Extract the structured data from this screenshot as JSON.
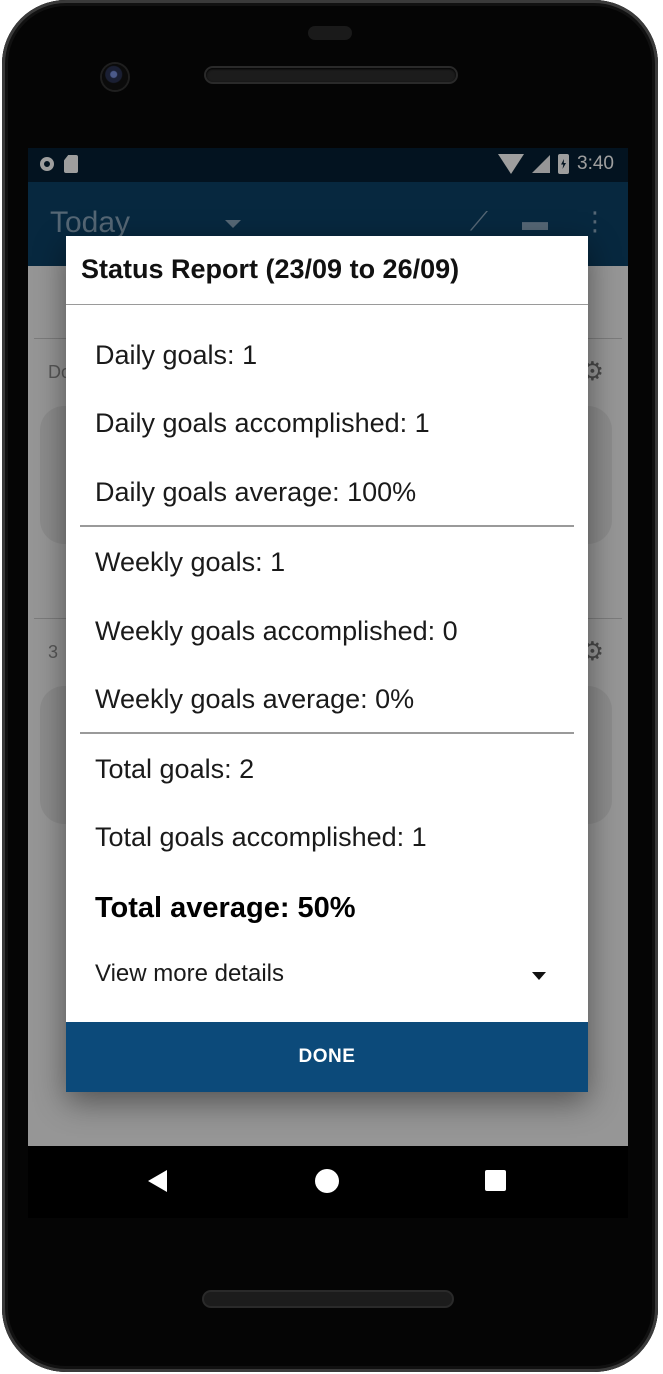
{
  "status_bar": {
    "time": "3:40"
  },
  "app_bar": {
    "title": "Today",
    "icons": [
      "chevron-down-icon",
      "chart-icon",
      "chat-icon",
      "more-vert-icon"
    ]
  },
  "background": {
    "card1_label": "Do",
    "card2_label": "3"
  },
  "dialog": {
    "title": "Status Report (23/09 to 26/09)",
    "daily": {
      "goals": "Daily goals: 1",
      "accomplished": "Daily goals accomplished: 1",
      "average": "Daily goals average: 100%"
    },
    "weekly": {
      "goals": "Weekly goals: 1",
      "accomplished": "Weekly goals accomplished: 0",
      "average": "Weekly goals average: 0%"
    },
    "total": {
      "goals": "Total goals: 2",
      "accomplished": "Total goals accomplished: 1",
      "average": "Total average: 50%"
    },
    "details_label": "View more details",
    "done_label": "DONE"
  },
  "colors": {
    "app_bar": "#0c4166",
    "status_bar": "#062034",
    "done_button": "#0c4a7a"
  }
}
